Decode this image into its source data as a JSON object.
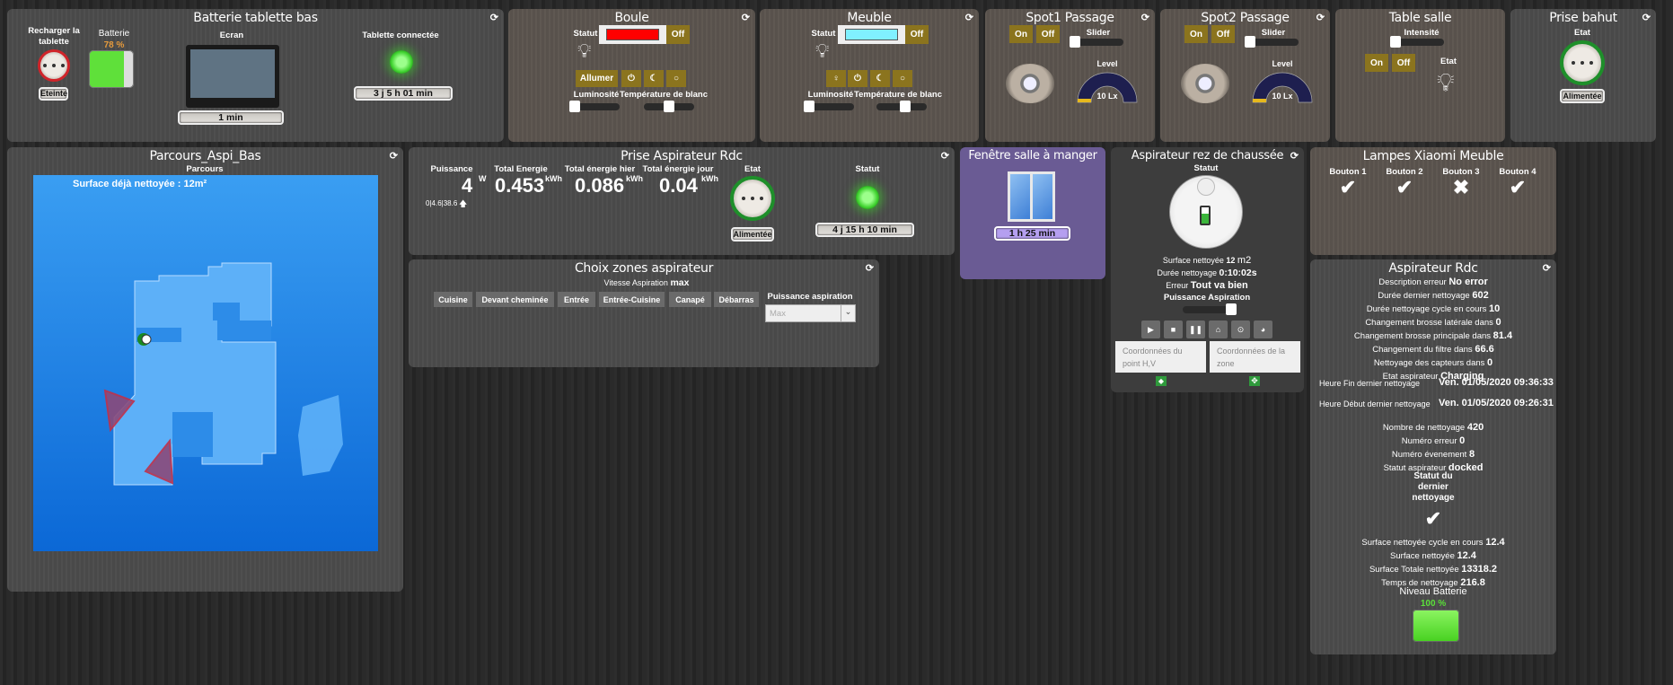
{
  "batterie_tablette": {
    "title": "Batterie tablette bas",
    "recharger_label": "Recharger la tablette",
    "recharger_state": "Eteinte",
    "batterie_label": "Batterie",
    "batterie_pct": "78 %",
    "batterie_level": 78,
    "ecran_label": "Ecran",
    "ecran_value": "1 min",
    "connectee_label": "Tablette connectée",
    "connectee_value": "3 j 5 h 01 min"
  },
  "boule": {
    "title": "Boule",
    "statut_label": "Statut",
    "color": "#ff0000",
    "off_label": "Off",
    "allumer_label": "Allumer",
    "luminosite_label": "Luminosité",
    "temperature_label": "Température de blanc",
    "luminosite_value": 0,
    "temperature_value": 50
  },
  "meuble": {
    "title": "Meuble",
    "statut_label": "Statut",
    "color": "#80f0ff",
    "off_label": "Off",
    "luminosite_label": "Luminosité",
    "temperature_label": "Température de blanc",
    "luminosite_value": 0,
    "temperature_value": 50
  },
  "spot1": {
    "title": "Spot1 Passage",
    "on_label": "On",
    "off_label": "Off",
    "slider_label": "Slider",
    "level_label": "Level",
    "level_value": "10 Lx"
  },
  "spot2": {
    "title": "Spot2 Passage",
    "on_label": "On",
    "off_label": "Off",
    "slider_label": "Slider",
    "level_label": "Level",
    "level_value": "10 Lx"
  },
  "table_salle": {
    "title": "Table salle",
    "intensite_label": "Intensité",
    "on_label": "On",
    "off_label": "Off",
    "etat_label": "Etat"
  },
  "prise_bahut": {
    "title": "Prise bahut",
    "etat_label": "Etat",
    "etat_value": "Alimentée"
  },
  "parcours": {
    "title": "Parcours_Aspi_Bas",
    "subtitle": "Parcours",
    "surface": "Surface déjà nettoyée : 12m²"
  },
  "prise_aspirateur": {
    "title": "Prise Aspirateur Rdc",
    "puissance_label": "Puissance",
    "puissance_value": "4",
    "puissance_unit": "W",
    "puissance_stats": "0|4.6|38.6",
    "total_label": "Total Energie",
    "total_value": "0.453",
    "hier_label": "Total énergie hier",
    "hier_value": "0.086",
    "jour_label": "Total énergie jour",
    "jour_value": "0.04",
    "kwh": "kWh",
    "etat_label": "Etat",
    "etat_value": "Alimentée",
    "statut_label": "Statut",
    "statut_value": "4 j 15 h 10 min"
  },
  "choix_zones": {
    "title": "Choix zones aspirateur",
    "vitesse_label": "Vitesse Aspiration",
    "vitesse_value": "max",
    "zones": [
      "Cuisine",
      "Devant cheminée",
      "Entrée",
      "Entrée-Cuisine",
      "Canapé",
      "Débarras"
    ],
    "puissance_label": "Puissance aspiration",
    "puissance_selected": "Max"
  },
  "fenetre": {
    "title": "Fenêtre salle à manger",
    "value": "1 h 25 min"
  },
  "aspirateur_rez": {
    "title": "Aspirateur rez de chaussée",
    "statut_label": "Statut",
    "surface_label": "Surface nettoyée",
    "surface_value": "12",
    "surface_unit": "m2",
    "duree_label": "Durée nettoyage",
    "duree_value": "0:10:02s",
    "erreur_label": "Erreur",
    "erreur_value": "Tout va bien",
    "puissance_label": "Puissance Aspiration",
    "point_placeholder": "Coordonnées du point H,V",
    "zone_placeholder": "Coordonnées de la zone"
  },
  "lampes_xiaomi": {
    "title": "Lampes Xiaomi Meuble",
    "boutons": [
      {
        "label": "Bouton 1",
        "state": "on"
      },
      {
        "label": "Bouton 2",
        "state": "on"
      },
      {
        "label": "Bouton 3",
        "state": "off"
      },
      {
        "label": "Bouton 4",
        "state": "on"
      }
    ]
  },
  "aspirateur_rdc": {
    "title": "Aspirateur Rdc",
    "rows1": [
      {
        "label": "Description erreur",
        "value": "No error"
      },
      {
        "label": "Durée dernier nettoyage",
        "value": "602"
      },
      {
        "label": "Durée nettoyage cycle en cours",
        "value": "10"
      },
      {
        "label": "Changement brosse latérale dans",
        "value": "0"
      },
      {
        "label": "Changement brosse principale dans",
        "value": "81.4"
      },
      {
        "label": "Changement du filtre dans",
        "value": "66.6"
      },
      {
        "label": "Nettoyage des capteurs dans",
        "value": "0"
      },
      {
        "label": "Etat aspirateur",
        "value": "Charging"
      }
    ],
    "heure_fin_label": "Heure Fin dernier nettoyage",
    "heure_fin_value": "Ven. 01/05/2020 09:36:33",
    "heure_debut_label": "Heure Début dernier nettoyage",
    "heure_debut_value": "Ven. 01/05/2020 09:26:31",
    "rows2": [
      {
        "label": "Nombre de nettoyage",
        "value": "420"
      },
      {
        "label": "Numéro erreur",
        "value": "0"
      },
      {
        "label": "Numéro évenement",
        "value": "8"
      },
      {
        "label": "Statut aspirateur",
        "value": "docked"
      }
    ],
    "statut_dernier_label": "Statut du dernier nettoyage",
    "rows3": [
      {
        "label": "Surface nettoyée cycle en cours",
        "value": "12.4"
      },
      {
        "label": "Surface nettoyée",
        "value": "12.4"
      },
      {
        "label": "Surface Totale nettoyée",
        "value": "13318.2"
      },
      {
        "label": "Temps de nettoyage",
        "value": "216.8"
      }
    ],
    "batterie_label": "Niveau Batterie",
    "batterie_pct": "100 %",
    "batterie_level": 100
  }
}
